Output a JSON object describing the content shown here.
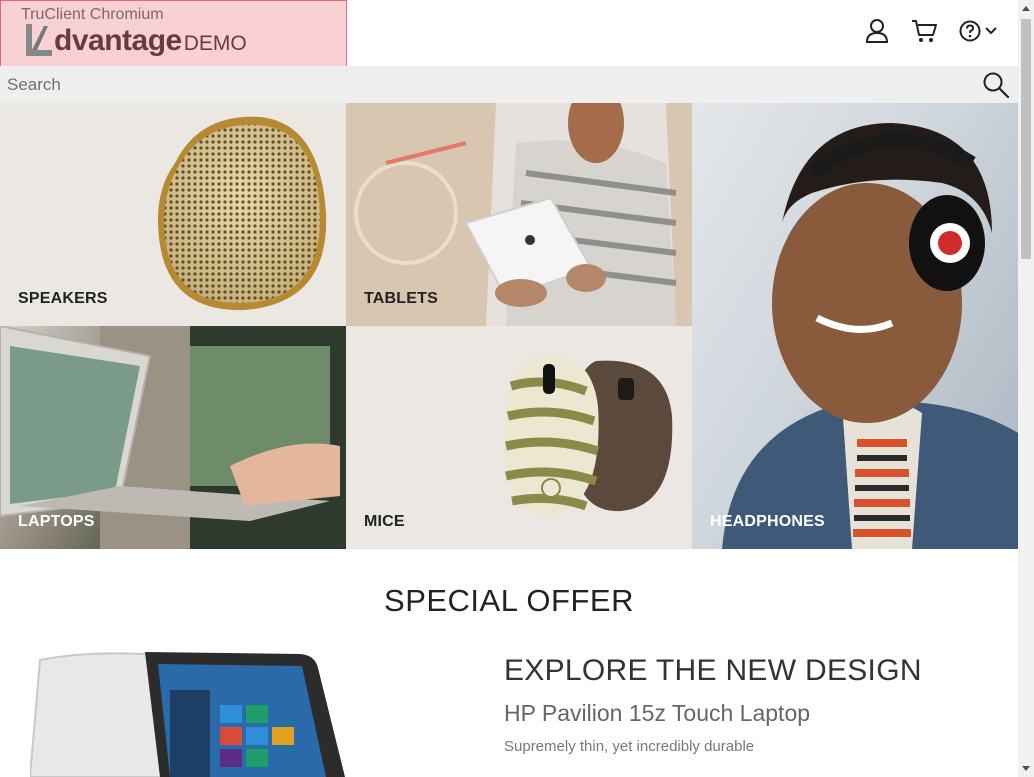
{
  "overlay": {
    "label": "TruClient Chromium"
  },
  "logo": {
    "main": "dvantage",
    "suffix": "DEMO"
  },
  "header": {
    "icons": [
      "user-icon",
      "cart-icon",
      "help-icon",
      "chevron-down-icon"
    ]
  },
  "search": {
    "placeholder": "Search"
  },
  "categories": [
    {
      "label": "SPEAKERS"
    },
    {
      "label": "TABLETS"
    },
    {
      "label": "LAPTOPS"
    },
    {
      "label": "MICE"
    },
    {
      "label": "HEADPHONES"
    }
  ],
  "special_offer": {
    "title": "SPECIAL OFFER",
    "headline": "EXPLORE THE NEW DESIGN",
    "product": "HP Pavilion 15z Touch Laptop",
    "description": "Supremely thin, yet incredibly durable"
  },
  "colors": {
    "logo_teal": "#3f8a85",
    "overlay_red": "#e36c73",
    "search_bg": "#efefef"
  }
}
